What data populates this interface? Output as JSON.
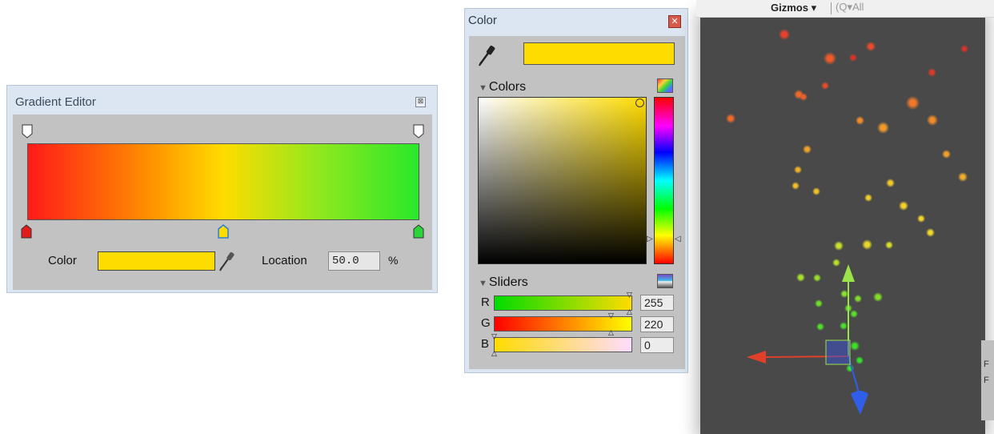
{
  "gradient_editor": {
    "title": "Gradient Editor",
    "close_glyph": "⊠",
    "color_label": "Color",
    "color_value": "#ffdc00",
    "location_label": "Location",
    "location_value": "50.0",
    "location_unit": "%",
    "gradient_stops": [
      "#ff1a1a",
      "#ffdc00",
      "#29e82a"
    ],
    "alpha_keys": [
      "start",
      "end"
    ],
    "color_keys": [
      {
        "color": "#e21b1b",
        "position": 0
      },
      {
        "color": "#ffdc00",
        "position": 50
      },
      {
        "color": "#2ad43a",
        "position": 100
      }
    ]
  },
  "color_picker": {
    "title": "Color",
    "close_glyph": "✕",
    "current_color": "#ffdc00",
    "colors_section": "Colors",
    "sliders_section": "Sliders",
    "sliders": [
      {
        "label": "R",
        "value": "255"
      },
      {
        "label": "G",
        "value": "220"
      },
      {
        "label": "B",
        "value": "0"
      }
    ]
  },
  "scene_view": {
    "gizmos_label": "Gizmos ▾",
    "search_placeholder": "(Q▾All",
    "axis_colors": {
      "x": "#e0402a",
      "y": "#9be34a",
      "z": "#2f5fe8"
    }
  }
}
